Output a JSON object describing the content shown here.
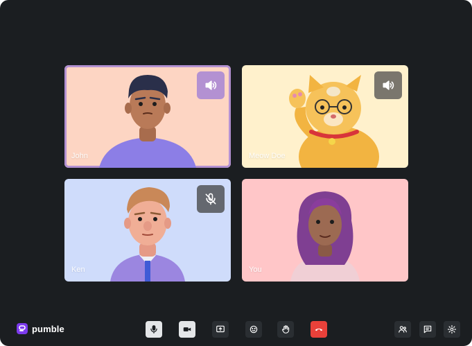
{
  "brand": {
    "name": "pumble"
  },
  "participants": [
    {
      "name": "John",
      "bg": "#fdd5c3",
      "audio": "speaker",
      "active": true
    },
    {
      "name": "Meow Doe",
      "bg": "#fff1cc",
      "audio": "speaker",
      "active": false
    },
    {
      "name": "Ken",
      "bg": "#cfdcfb",
      "audio": "muted",
      "active": false
    },
    {
      "name": "You",
      "bg": "#ffc6c8",
      "audio": "none",
      "active": false
    }
  ],
  "controls": {
    "mic": "microphone-icon",
    "camera": "video-camera-icon",
    "share": "share-screen-icon",
    "emoji": "emoji-icon",
    "hand": "raise-hand-icon",
    "leave": "hang-up-icon",
    "people": "participants-icon",
    "chat": "chat-icon",
    "settings": "gear-icon"
  },
  "colors": {
    "window_bg": "#1b1e21",
    "accent": "#b391d2",
    "danger": "#e9413a",
    "brand": "#7c3aed"
  }
}
